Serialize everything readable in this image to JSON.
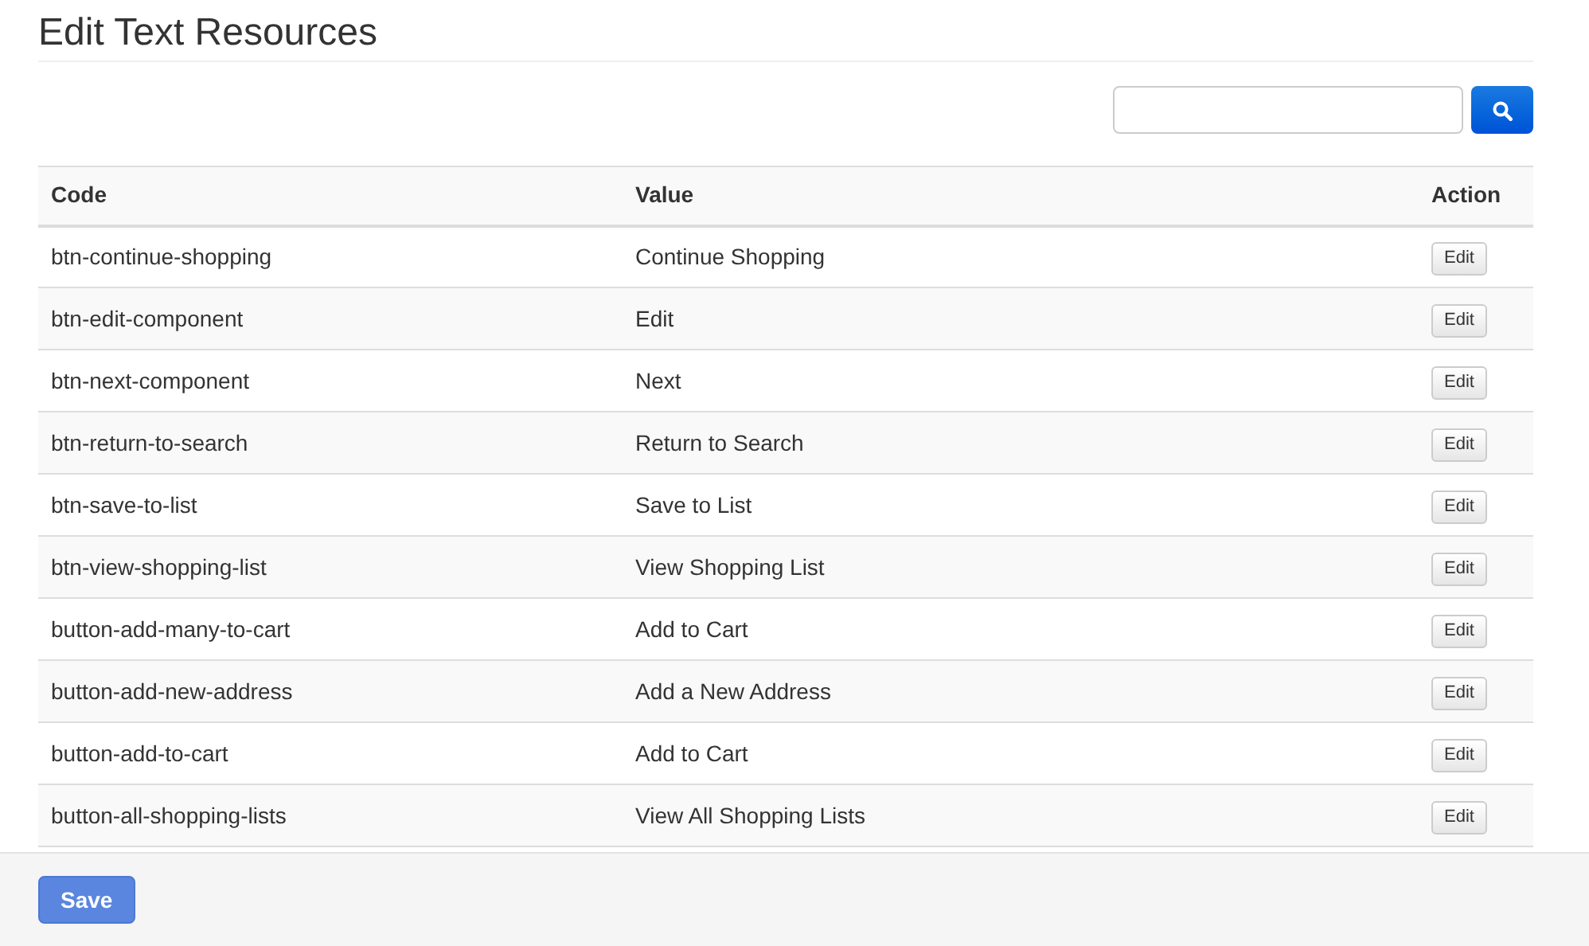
{
  "title": "Edit Text Resources",
  "table": {
    "columns": [
      "Code",
      "Value",
      "Action"
    ],
    "rows": [
      {
        "code": "btn-continue-shopping",
        "value": "Continue Shopping",
        "action": "Edit"
      },
      {
        "code": "btn-edit-component",
        "value": "Edit",
        "action": "Edit"
      },
      {
        "code": "btn-next-component",
        "value": "Next",
        "action": "Edit"
      },
      {
        "code": "btn-return-to-search",
        "value": "Return to Search",
        "action": "Edit"
      },
      {
        "code": "btn-save-to-list",
        "value": "Save to List",
        "action": "Edit"
      },
      {
        "code": "btn-view-shopping-list",
        "value": "View Shopping List",
        "action": "Edit"
      },
      {
        "code": "button-add-many-to-cart",
        "value": "Add to Cart",
        "action": "Edit"
      },
      {
        "code": "button-add-new-address",
        "value": "Add a New Address",
        "action": "Edit"
      },
      {
        "code": "button-add-to-cart",
        "value": "Add to Cart",
        "action": "Edit"
      },
      {
        "code": "button-all-shopping-lists",
        "value": "View All Shopping Lists",
        "action": "Edit"
      }
    ]
  },
  "footer": {
    "button": "Save"
  }
}
